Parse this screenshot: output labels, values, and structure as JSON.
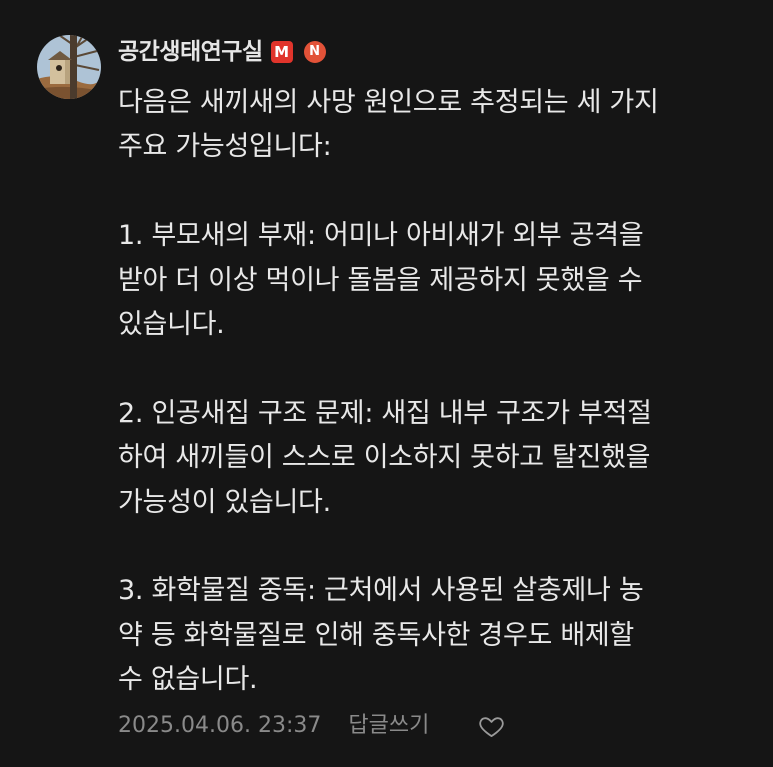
{
  "comment": {
    "author": "공간생태연구실",
    "badges": {
      "manager": "M",
      "new": "N"
    },
    "paragraphs": [
      {
        "lines": [
          "다음은 새끼새의 사망 원인으로 추정되는 세 가지",
          "주요 가능성입니다:"
        ]
      },
      {
        "lines": [
          "1. 부모새의 부재: 어미나 아비새가 외부 공격을",
          "받아 더 이상 먹이나 돌봄을 제공하지 못했을 수",
          "있습니다."
        ]
      },
      {
        "lines": [
          "2. 인공새집 구조 문제: 새집 내부 구조가 부적절",
          "하여 새끼들이 스스로 이소하지 못하고 탈진했을",
          "가능성이 있습니다."
        ]
      },
      {
        "lines": [
          "3. 화학물질 중독: 근처에서 사용된 살충제나 농",
          "약 등 화학물질로 인해 중독사한 경우도 배제할",
          "수 없습니다."
        ]
      }
    ],
    "timestamp": "2025.04.06. 23:37",
    "reply_label": "답글쓰기",
    "like_icon": "heart-outline-icon"
  },
  "theme": {
    "background": "#151515",
    "text": "#e8e8e8",
    "author": "#e6e6e6",
    "muted": "#8a8a8a",
    "badge_manager": "#e0342b",
    "badge_new": "#e25238"
  }
}
